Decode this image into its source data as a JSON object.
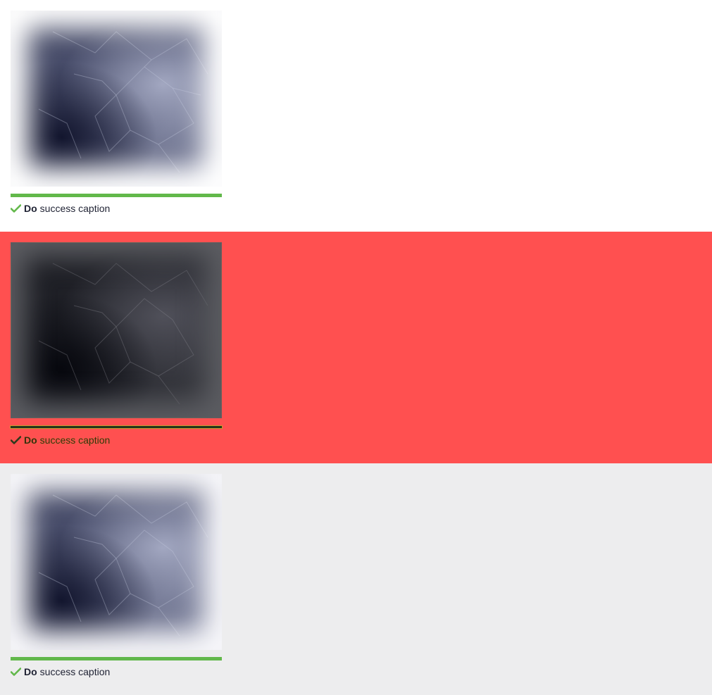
{
  "examples": [
    {
      "variant": "white",
      "caption_strong": "Do",
      "caption_text": "success caption",
      "icon": "checkmark-icon"
    },
    {
      "variant": "red",
      "caption_strong": "Do",
      "caption_text": "success caption",
      "icon": "checkmark-icon"
    },
    {
      "variant": "gray",
      "caption_strong": "Do",
      "caption_text": "success caption",
      "icon": "checkmark-icon"
    }
  ],
  "colors": {
    "success": "#62b84a",
    "red_background": "#ff5050",
    "gray_background": "#ededee",
    "text": "#1f2233"
  }
}
